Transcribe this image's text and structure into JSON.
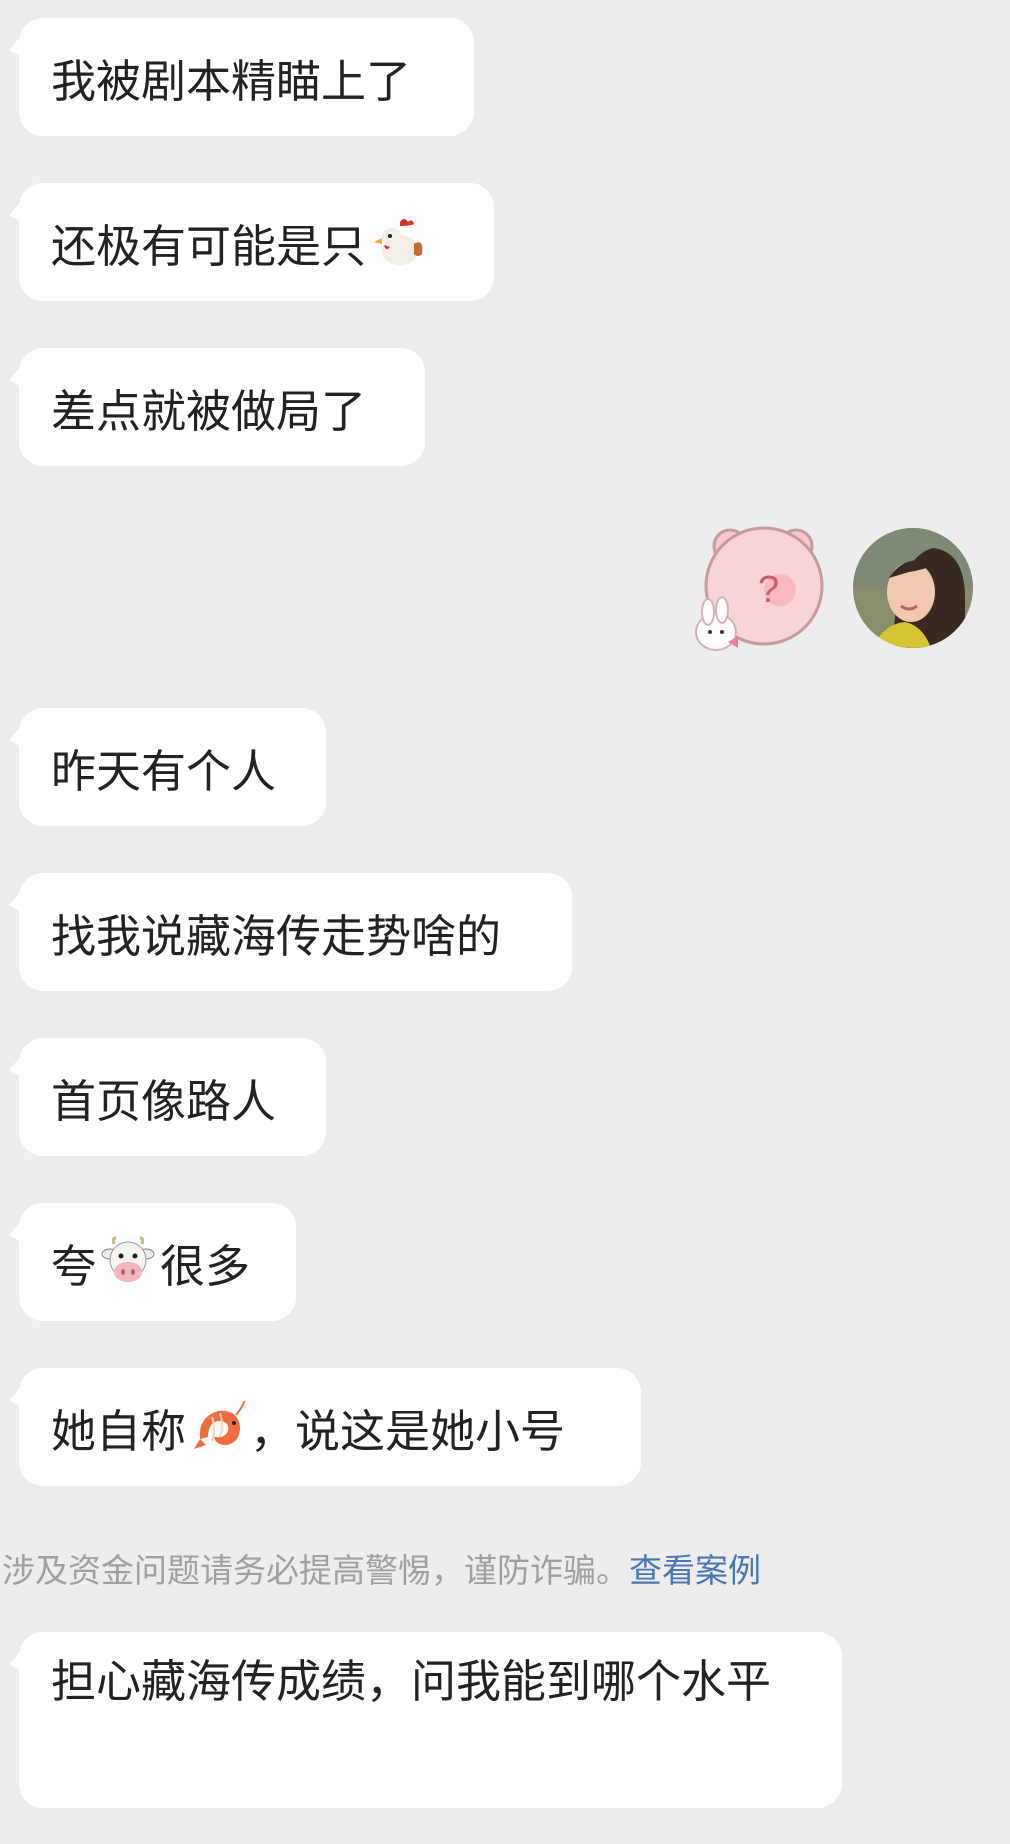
{
  "messages": [
    {
      "text": "我被剧本精瞄上了"
    },
    {
      "text_before": "还极有可能是只",
      "emoji": "rooster-emoji"
    },
    {
      "text": "差点就被做局了"
    },
    {
      "text": "昨天有个人"
    },
    {
      "text": "找我说藏海传走势啥的"
    },
    {
      "text": "首页像路人"
    },
    {
      "text_before": "夸",
      "emoji": "cow-face-emoji",
      "text_after": "很多"
    },
    {
      "text_before": "她自称",
      "emoji": "shrimp-emoji",
      "text_after": "，说这是她小号"
    },
    {
      "text": "担心藏海传成绩，问我能到哪个水平"
    }
  ],
  "outgoing": {
    "sticker": "pink-bear-question-sticker",
    "sticker_mark": "?",
    "avatar": "user-avatar-photo"
  },
  "warning": {
    "text": "涉及资金问题请务必提高警惕，谨防诈骗。",
    "link": "查看案例"
  },
  "colors": {
    "background": "#ededed",
    "bubble": "#ffffff",
    "text": "#222222",
    "warning": "#a0a0a0",
    "link": "#4a77b0"
  }
}
